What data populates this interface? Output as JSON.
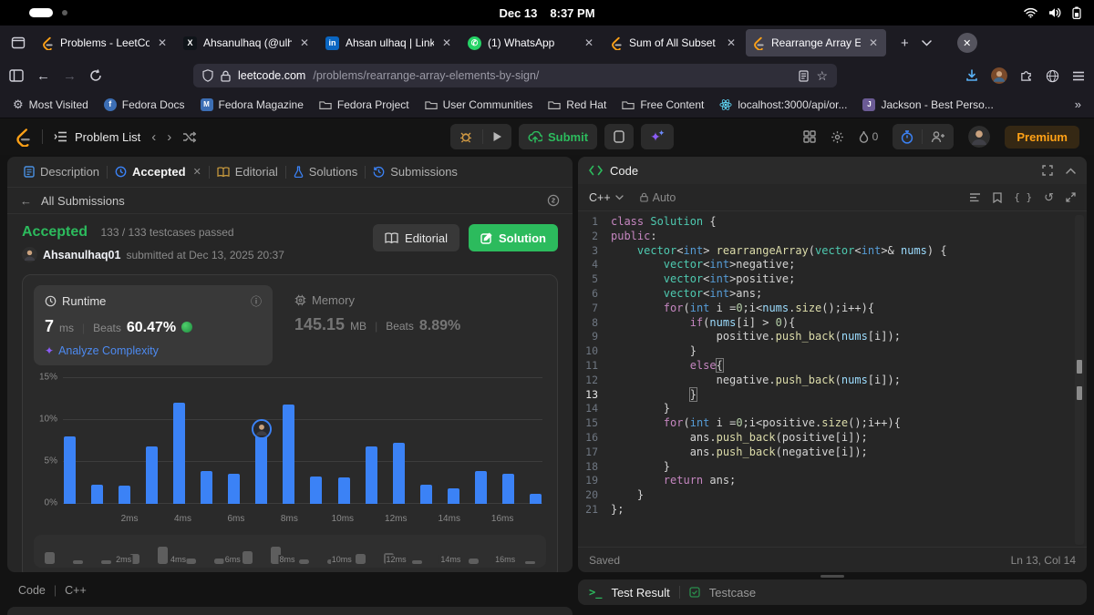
{
  "colors": {
    "accent_blue": "#3b82f6",
    "leetcode_orange": "#ffa116",
    "green": "#2cbb5d"
  },
  "system_bar": {
    "date": "Dec 13",
    "time": "8:37 PM"
  },
  "browser": {
    "tabs": [
      {
        "label": "Problems - LeetCode",
        "icon": "leetcode",
        "active": false
      },
      {
        "label": "Ahsanulhaq (@ulha",
        "icon": "x",
        "active": false
      },
      {
        "label": "Ahsan ulhaq | Linke",
        "icon": "linkedin",
        "active": false
      },
      {
        "label": "(1) WhatsApp",
        "icon": "whatsapp",
        "active": false
      },
      {
        "label": "Sum of All Subset",
        "icon": "leetcode",
        "active": false
      },
      {
        "label": "Rearrange Array Ele",
        "icon": "leetcode",
        "active": true
      }
    ],
    "url": {
      "host": "leetcode.com",
      "path": "/problems/rearrange-array-elements-by-sign/"
    },
    "bookmarks": [
      {
        "label": "Most Visited",
        "icon": "gear"
      },
      {
        "label": "Fedora Docs",
        "icon": "fedora-docs"
      },
      {
        "label": "Fedora Magazine",
        "icon": "fedora-magazine"
      },
      {
        "label": "Fedora Project",
        "icon": "folder"
      },
      {
        "label": "User Communities",
        "icon": "folder"
      },
      {
        "label": "Red Hat",
        "icon": "folder"
      },
      {
        "label": "Free Content",
        "icon": "folder"
      },
      {
        "label": "localhost:3000/api/or...",
        "icon": "react"
      },
      {
        "label": "Jackson - Best Perso...",
        "icon": "jackson"
      }
    ]
  },
  "leetcode_nav": {
    "problem_list": "Problem List",
    "submit": "Submit",
    "streak": "0",
    "premium": "Premium"
  },
  "left_panel": {
    "tabs": [
      {
        "label": "Description",
        "icon": "description",
        "active": false,
        "closable": false
      },
      {
        "label": "Accepted",
        "icon": "clock",
        "active": true,
        "closable": true
      },
      {
        "label": "Editorial",
        "icon": "book",
        "active": false,
        "closable": false
      },
      {
        "label": "Solutions",
        "icon": "flask",
        "active": false,
        "closable": false
      },
      {
        "label": "Submissions",
        "icon": "history",
        "active": false,
        "closable": false
      }
    ],
    "back_label": "All Submissions",
    "submission": {
      "status": "Accepted",
      "testcases": "133 / 133 testcases passed",
      "username": "Ahsanulhaq01",
      "submitted_at": "submitted at Dec 13, 2025 20:37",
      "editorial_btn": "Editorial",
      "solution_btn": "Solution"
    },
    "stats": {
      "runtime": {
        "label": "Runtime",
        "value": "7",
        "unit": "ms",
        "beats_label": "Beats",
        "beats_value": "60.47%",
        "analyze_label": "Analyze Complexity"
      },
      "memory": {
        "label": "Memory",
        "value": "145.15",
        "unit": "MB",
        "beats_label": "Beats",
        "beats_value": "8.89%"
      }
    },
    "footer": {
      "code": "Code",
      "lang": "C++"
    }
  },
  "chart_data": {
    "type": "bar",
    "title": "Runtime distribution (percentile of submissions per runtime)",
    "x_ms": [
      0,
      1,
      2,
      3,
      4,
      5,
      6,
      7,
      8,
      9,
      10,
      11,
      12,
      13,
      14,
      15,
      16,
      17
    ],
    "values_percent": [
      8.0,
      2.3,
      2.2,
      6.9,
      12.1,
      3.9,
      3.6,
      8.9,
      11.9,
      3.3,
      3.2,
      6.8,
      7.3,
      2.3,
      1.9,
      3.9,
      3.6,
      1.2
    ],
    "x_tick_indices": [
      2,
      4,
      6,
      8,
      10,
      12,
      14,
      16
    ],
    "x_tick_labels": [
      "2ms",
      "4ms",
      "6ms",
      "8ms",
      "10ms",
      "12ms",
      "14ms",
      "16ms"
    ],
    "y_ticks": [
      0,
      5,
      10,
      15
    ],
    "y_tick_labels": [
      "0%",
      "5%",
      "10%",
      "15%"
    ],
    "ylim": [
      0,
      15
    ],
    "grid": true,
    "marker_index": 7,
    "bar_color": "#3b82f6"
  },
  "editor": {
    "title": "Code",
    "language": "C++",
    "mode": "Auto",
    "status_left": "Saved",
    "status_right": "Ln 13, Col 14",
    "active_line": 13,
    "lines": [
      "class Solution {",
      "public:",
      "    vector<int> rearrangeArray(vector<int>& nums) {",
      "        vector<int>negative;",
      "        vector<int>positive;",
      "        vector<int>ans;",
      "        for(int i =0;i<nums.size();i++){",
      "            if(nums[i] > 0){",
      "                positive.push_back(nums[i]);",
      "            }",
      "            else{",
      "                negative.push_back(nums[i]);",
      "            }",
      "        }",
      "        for(int i =0;i<positive.size();i++){",
      "            ans.push_back(positive[i]);",
      "            ans.push_back(negative[i]);",
      "        }",
      "        return ans;",
      "    }",
      "};"
    ]
  },
  "test_panel": {
    "result_tab": "Test Result",
    "testcase_tab": "Testcase"
  }
}
